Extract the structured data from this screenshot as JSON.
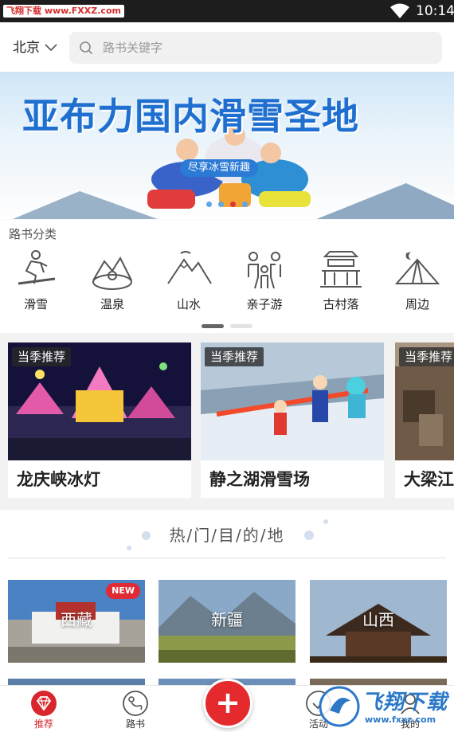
{
  "status_bar": {
    "watermark": "飞翔下载 www.FXXZ.com",
    "time": "10:14"
  },
  "header": {
    "city": "北京",
    "search_placeholder": "路书关键字"
  },
  "banner": {
    "title": "亚布力国内滑雪圣地",
    "subtitle": "尽享冰雪新趣",
    "slide_count": 4,
    "active_slide": 3
  },
  "categories": {
    "heading": "路书分类",
    "items": [
      {
        "label": "滑雪",
        "icon": "ski-icon"
      },
      {
        "label": "温泉",
        "icon": "hot-spring-icon"
      },
      {
        "label": "山水",
        "icon": "mountain-icon"
      },
      {
        "label": "亲子游",
        "icon": "family-icon"
      },
      {
        "label": "古村落",
        "icon": "ancient-village-icon"
      },
      {
        "label": "周边",
        "icon": "tent-icon"
      }
    ],
    "page_count": 2,
    "active_page": 1
  },
  "recommend": {
    "badge": "当季推荐",
    "cards": [
      {
        "title": "龙庆峡冰灯"
      },
      {
        "title": "静之湖滑雪场"
      },
      {
        "title": "大梁江"
      }
    ]
  },
  "hot": {
    "title": "热/门/目/的/地",
    "destinations": [
      {
        "name": "西藏",
        "badge": "NEW"
      },
      {
        "name": "新疆",
        "badge": ""
      },
      {
        "name": "山西",
        "badge": ""
      }
    ]
  },
  "bottom_nav": {
    "items": [
      {
        "label": "推荐",
        "active": true
      },
      {
        "label": "路书",
        "active": false
      },
      {
        "label": "活动",
        "active": false
      },
      {
        "label": "我的",
        "active": false
      }
    ],
    "fab_label": "+",
    "brand_watermark": "飞翔下载",
    "brand_url": "www.fxxz.com"
  },
  "colors": {
    "accent": "#e42a2d",
    "banner_title": "#1f6fd0",
    "active_nav": "#d8262c"
  }
}
